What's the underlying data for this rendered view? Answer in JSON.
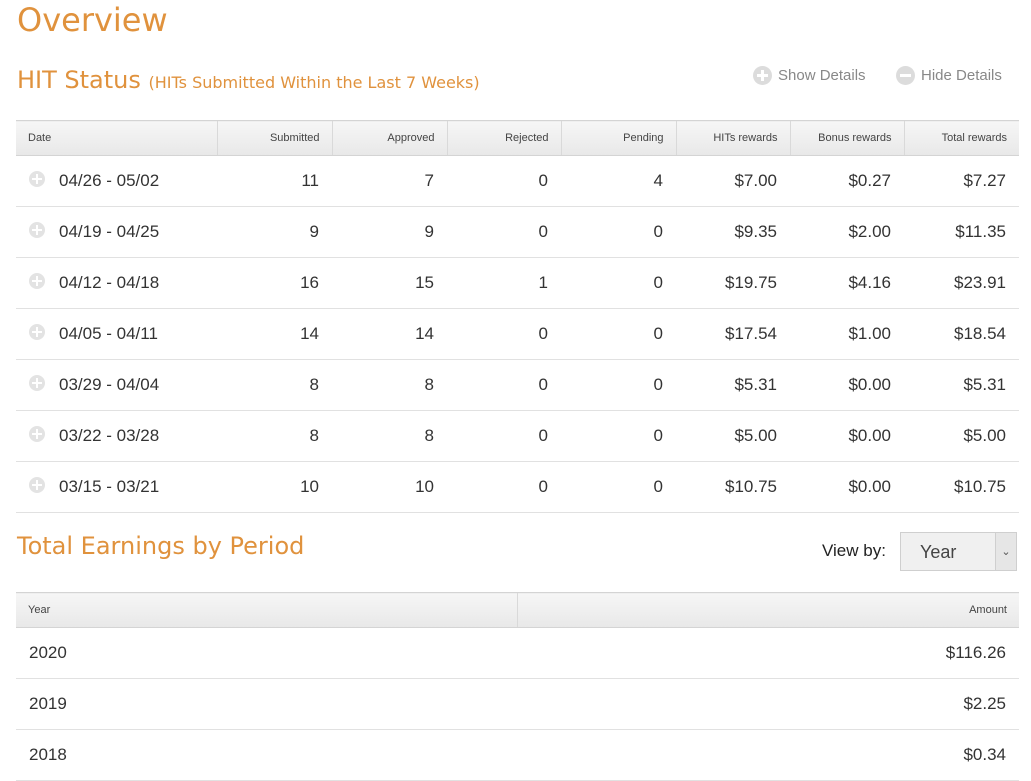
{
  "page": {
    "title": "Overview"
  },
  "hit_status": {
    "heading": "HIT Status",
    "subheading": "(HITs Submitted Within the Last 7 Weeks)",
    "show_details": "Show Details",
    "hide_details": "Hide Details",
    "columns": [
      "Date",
      "Submitted",
      "Approved",
      "Rejected",
      "Pending",
      "HITs rewards",
      "Bonus rewards",
      "Total rewards"
    ],
    "rows": [
      [
        "04/26 - 05/02",
        "11",
        "7",
        "0",
        "4",
        "$7.00",
        "$0.27",
        "$7.27"
      ],
      [
        "04/19 - 04/25",
        "9",
        "9",
        "0",
        "0",
        "$9.35",
        "$2.00",
        "$11.35"
      ],
      [
        "04/12 - 04/18",
        "16",
        "15",
        "1",
        "0",
        "$19.75",
        "$4.16",
        "$23.91"
      ],
      [
        "04/05 - 04/11",
        "14",
        "14",
        "0",
        "0",
        "$17.54",
        "$1.00",
        "$18.54"
      ],
      [
        "03/29 - 04/04",
        "8",
        "8",
        "0",
        "0",
        "$5.31",
        "$0.00",
        "$5.31"
      ],
      [
        "03/22 - 03/28",
        "8",
        "8",
        "0",
        "0",
        "$5.00",
        "$0.00",
        "$5.00"
      ],
      [
        "03/15 - 03/21",
        "10",
        "10",
        "0",
        "0",
        "$10.75",
        "$0.00",
        "$10.75"
      ]
    ]
  },
  "earnings": {
    "heading": "Total Earnings by Period",
    "view_by_label": "View by:",
    "view_by_value": "Year",
    "columns": [
      "Year",
      "Amount"
    ],
    "rows": [
      [
        "2020",
        "$116.26"
      ],
      [
        "2019",
        "$2.25"
      ],
      [
        "2018",
        "$0.34"
      ]
    ]
  },
  "icons": {
    "expand": "plus-circle-icon",
    "collapse": "minus-circle-icon",
    "dropdown": "chevron-down-icon"
  },
  "colors": {
    "accent": "#e0923d",
    "header_bg": "#eeeeee",
    "row_border": "#e1e1e1"
  }
}
